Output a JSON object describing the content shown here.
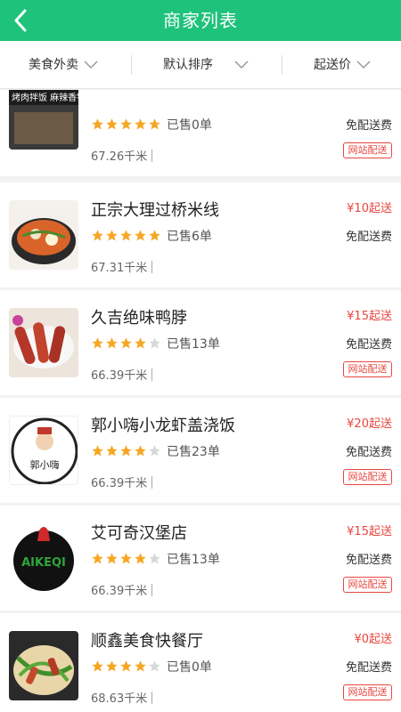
{
  "header": {
    "title": "商家列表",
    "back_icon": "chevron-left-icon"
  },
  "filters": [
    {
      "label": "美食外卖"
    },
    {
      "label": "默认排序"
    },
    {
      "label": "起送价"
    }
  ],
  "colors": {
    "brand": "#1ec27a",
    "star": "#f6a623",
    "star_empty": "#d8d8d8",
    "price": "#e8473f"
  },
  "merchants": [
    {
      "name": "",
      "stars": 5,
      "sold": "已售0单",
      "distance": "67.26千米",
      "min_price": "",
      "min_price_label": "",
      "fee": "免配送费",
      "badge": "网站配送",
      "thumb_text": "烤肉拌饭 麻辣香锅"
    },
    {
      "name": "正宗大理过桥米线",
      "stars": 5,
      "sold": "已售6单",
      "distance": "67.31千米",
      "min_price": "¥10",
      "min_price_label": "起送",
      "fee": "免配送费",
      "badge": ""
    },
    {
      "name": "久吉绝味鸭脖",
      "stars": 4,
      "sold": "已售13单",
      "distance": "66.39千米",
      "min_price": "¥15",
      "min_price_label": "起送",
      "fee": "免配送费",
      "badge": "网站配送"
    },
    {
      "name": "郭小嗨小龙虾盖浇饭",
      "stars": 4,
      "sold": "已售23单",
      "distance": "66.39千米",
      "min_price": "¥20",
      "min_price_label": "起送",
      "fee": "免配送费",
      "badge": "网站配送",
      "thumb_text": "郭小嗨"
    },
    {
      "name": "艾可奇汉堡店",
      "stars": 4,
      "sold": "已售13单",
      "distance": "66.39千米",
      "min_price": "¥15",
      "min_price_label": "起送",
      "fee": "免配送费",
      "badge": "网站配送",
      "thumb_text": "AIKEQI"
    },
    {
      "name": "顺鑫美食快餐厅",
      "stars": 4,
      "sold": "已售0单",
      "distance": "68.63千米",
      "min_price": "¥0",
      "min_price_label": "起送",
      "fee": "免配送费",
      "badge": "网站配送"
    }
  ]
}
